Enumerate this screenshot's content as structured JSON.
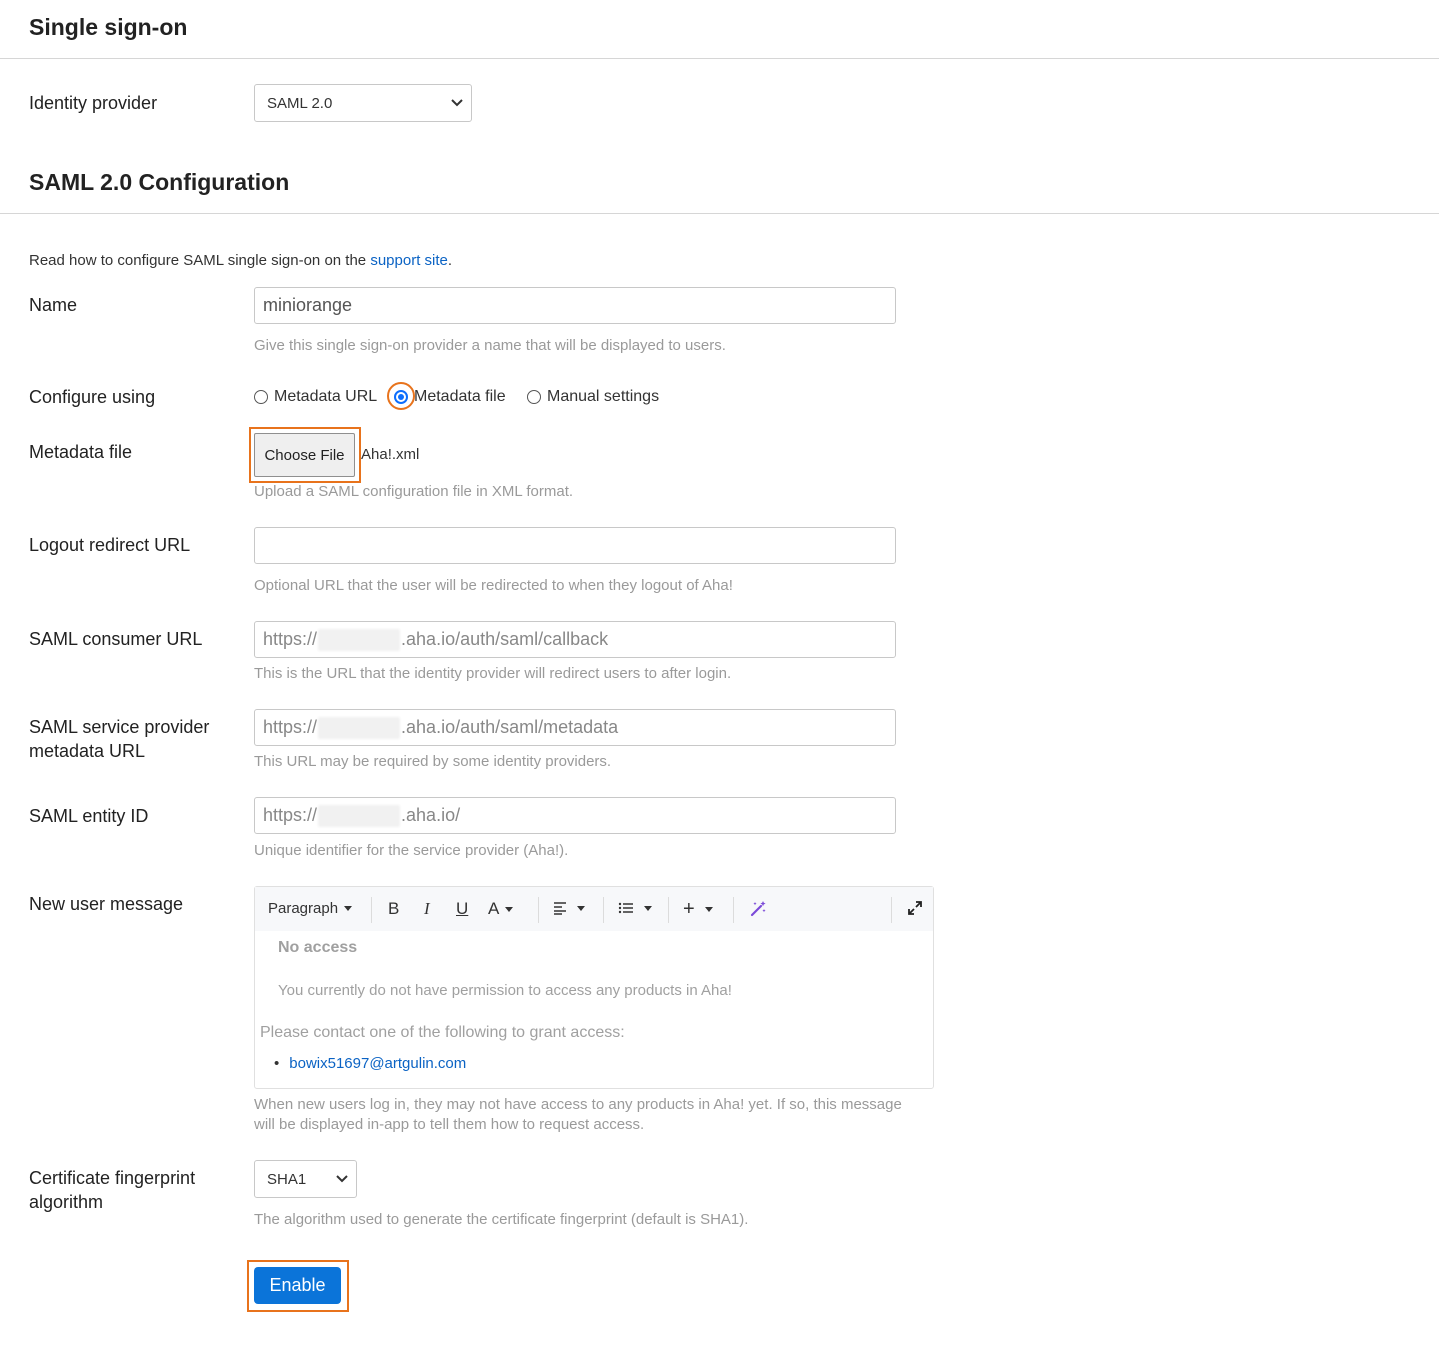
{
  "sso": {
    "title": "Single sign-on",
    "identity_provider_label": "Identity provider",
    "identity_provider_value": "SAML 2.0"
  },
  "saml": {
    "title": "SAML 2.0 Configuration",
    "intro_text": "Read how to configure SAML single sign-on on the",
    "intro_link": "support site",
    "intro_end": "."
  },
  "name": {
    "label": "Name",
    "value": "miniorange",
    "hint": "Give this single sign-on provider a name that will be displayed to users."
  },
  "configure": {
    "label": "Configure using",
    "options": [
      "Metadata URL",
      "Metadata file",
      "Manual settings"
    ],
    "selected": "Metadata file"
  },
  "metadata_file": {
    "label": "Metadata file",
    "button": "Choose File",
    "filename": "Aha!.xml",
    "hint": "Upload a SAML configuration file in XML format."
  },
  "logout": {
    "label": "Logout redirect URL",
    "value": "",
    "hint": "Optional URL that the user will be redirected to when they logout of Aha!"
  },
  "consumer": {
    "label": "SAML consumer URL",
    "prefix": "https://",
    "suffix": ".aha.io/auth/saml/callback",
    "hint": "This is the URL that the identity provider will redirect users to after login."
  },
  "sp_metadata": {
    "label_line1": "SAML service provider",
    "label_line2": "metadata URL",
    "prefix": "https://",
    "suffix": ".aha.io/auth/saml/metadata",
    "hint": "This URL may be required by some identity providers."
  },
  "entity": {
    "label": "SAML entity ID",
    "prefix": "https://",
    "suffix": ".aha.io/",
    "hint": "Unique identifier for the service provider (Aha!)."
  },
  "new_user": {
    "label": "New user message",
    "toolbar": {
      "paragraph": "Paragraph",
      "bold": "B",
      "italic": "I",
      "underline": "U",
      "font_color": "A",
      "insert": "+"
    },
    "heading": "No access",
    "line1": "You currently do not have permission to access any products in Aha!",
    "line2": "Please contact one of the following to grant access:",
    "email": "bowix51697@artgulin.com",
    "hint_line1": "When new users log in, they may not have access to any products in Aha! yet. If so, this message",
    "hint_line2": "will be displayed in-app to tell them how to request access."
  },
  "fingerprint": {
    "label_line1": "Certificate fingerprint",
    "label_line2": "algorithm",
    "value": "SHA1",
    "hint": "The algorithm used to generate the certificate fingerprint (default is SHA1)."
  },
  "enable_button": "Enable",
  "colors": {
    "primary": "#0b74d9",
    "highlight": "#e8731c",
    "link": "#0b63c4"
  }
}
